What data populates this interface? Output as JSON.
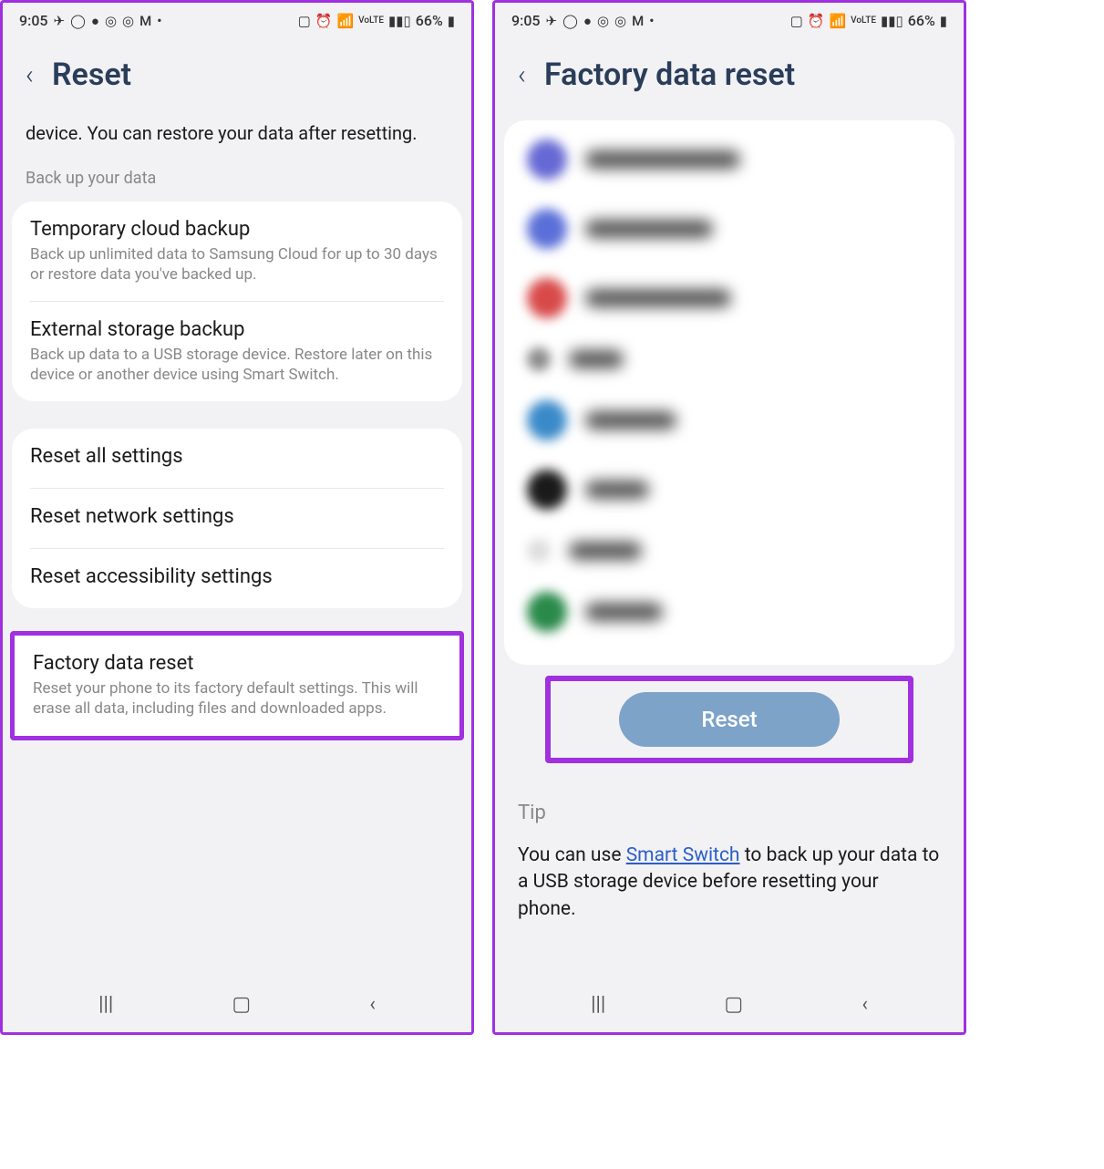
{
  "status": {
    "time": "9:05",
    "battery": "66%"
  },
  "phone1": {
    "title": "Reset",
    "intro": "device. You can restore your data after resetting.",
    "section_label": "Back up your data",
    "backup_items": [
      {
        "title": "Temporary cloud backup",
        "desc": "Back up unlimited data to Samsung Cloud for up to 30 days or restore data you've backed up."
      },
      {
        "title": "External storage backup",
        "desc": "Back up data to a USB storage device. Restore later on this device or another device using Smart Switch."
      }
    ],
    "reset_items": [
      {
        "title": "Reset all settings"
      },
      {
        "title": "Reset network settings"
      },
      {
        "title": "Reset accessibility settings"
      }
    ],
    "factory": {
      "title": "Factory data reset",
      "desc": "Reset your phone to its factory default settings. This will erase all data, including files and downloaded apps."
    }
  },
  "phone2": {
    "title": "Factory data reset",
    "reset_button": "Reset",
    "tip_label": "Tip",
    "tip_text_pre": "You can use ",
    "tip_link": "Smart Switch",
    "tip_text_post": " to back up your data to a USB storage device before resetting your phone."
  }
}
